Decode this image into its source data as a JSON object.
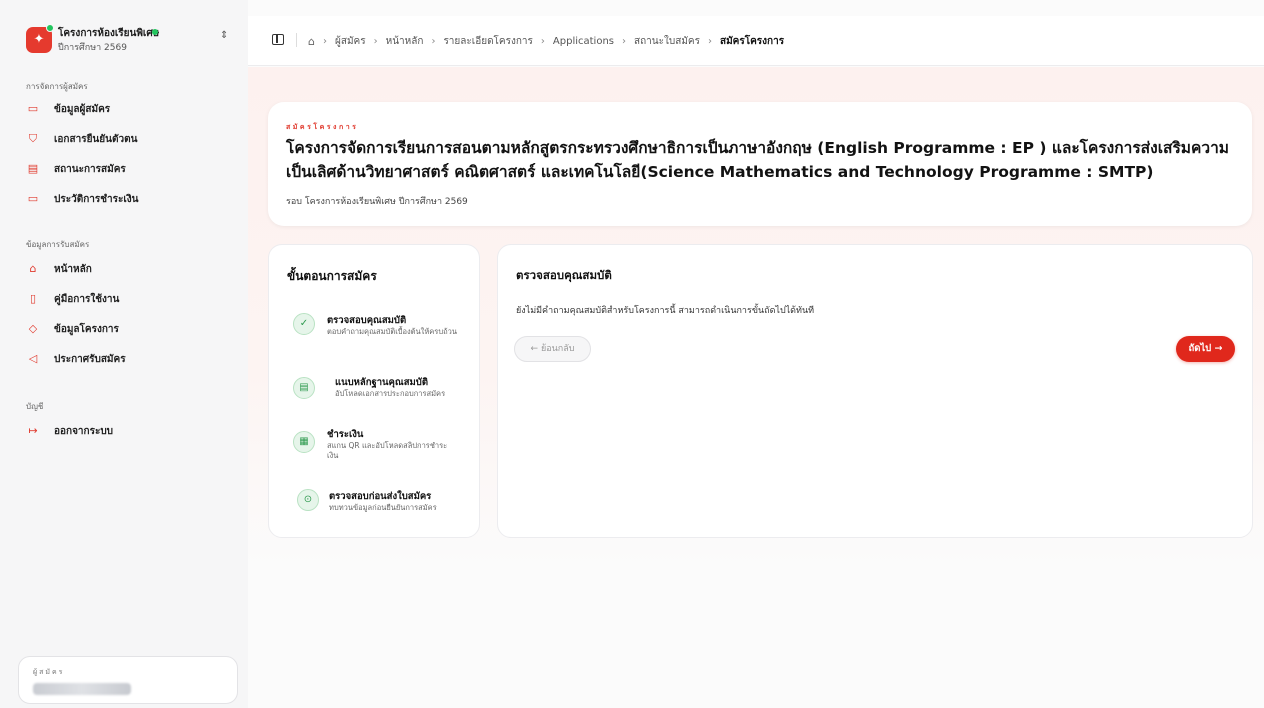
{
  "org": {
    "name": "โครงการห้องเรียนพิเศษ",
    "year": "ปีการศึกษา 2569"
  },
  "sidebar": {
    "groups": [
      {
        "title": "การจัดการผู้สมัคร",
        "items": [
          {
            "label": "ข้อมูลผู้สมัคร",
            "icon": "id-card-icon"
          },
          {
            "label": "เอกสารยืนยันตัวตน",
            "icon": "shield-icon"
          },
          {
            "label": "สถานะการสมัคร",
            "icon": "clipboard-icon"
          },
          {
            "label": "ประวัติการชำระเงิน",
            "icon": "credit-card-icon"
          }
        ]
      },
      {
        "title": "ข้อมูลการรับสมัคร",
        "items": [
          {
            "label": "หน้าหลัก",
            "icon": "home-icon"
          },
          {
            "label": "คู่มือการใช้งาน",
            "icon": "book-icon"
          },
          {
            "label": "ข้อมูลโครงการ",
            "icon": "graduation-cap-icon"
          },
          {
            "label": "ประกาศรับสมัคร",
            "icon": "megaphone-icon"
          }
        ]
      },
      {
        "title": "บัญชี",
        "items": [
          {
            "label": "ออกจากระบบ",
            "icon": "logout-icon"
          }
        ]
      }
    ]
  },
  "user": {
    "caption": "ผู้สมัคร"
  },
  "breadcrumb": [
    "ผู้สมัคร",
    "หน้าหลัก",
    "รายละเอียดโครงการ",
    "Applications",
    "สถานะใบสมัคร",
    "สมัครโครงการ"
  ],
  "hero": {
    "kicker": "สมัครโครงการ",
    "title": "โครงการจัดการเรียนการสอนตามหลักสูตรกระทรวงศึกษาธิการเป็นภาษาอังกฤษ (English Programme : EP ) และโครงการส่งเสริมความเป็นเลิศด้านวิทยาศาสตร์ คณิตศาสตร์ และเทคโนโลยี(Science Mathematics and Technology Programme : SMTP)",
    "round": "รอบ โครงการห้องเรียนพิเศษ ปีการศึกษา 2569"
  },
  "steps": {
    "title": "ขั้นตอนการสมัคร",
    "items": [
      {
        "title": "ตรวจสอบคุณสมบัติ",
        "desc": "ตอบคำถามคุณสมบัติเบื้องต้นให้ครบถ้วน",
        "icon": "clipboard-check-icon"
      },
      {
        "title": "แนบหลักฐานคุณสมบัติ",
        "desc": "อัปโหลดเอกสารประกอบการสมัคร",
        "icon": "document-icon"
      },
      {
        "title": "ชำระเงิน",
        "desc": "สแกน QR และอัปโหลดสลิปการชำระเงิน",
        "icon": "qr-code-icon"
      },
      {
        "title": "ตรวจสอบก่อนส่งใบสมัคร",
        "desc": "ทบทวนข้อมูลก่อนยืนยันการสมัคร",
        "icon": "check-circle-icon"
      }
    ]
  },
  "panel": {
    "title": "ตรวจสอบคุณสมบัติ",
    "message": "ยังไม่มีคำถามคุณสมบัติสำหรับโครงการนี้ สามารถดำเนินการขั้นถัดไปได้ทันที",
    "back_label": "ย้อนกลับ",
    "next_label": "ถัดไป"
  },
  "colors": {
    "accent": "#e0281c",
    "success": "#22c55e"
  }
}
